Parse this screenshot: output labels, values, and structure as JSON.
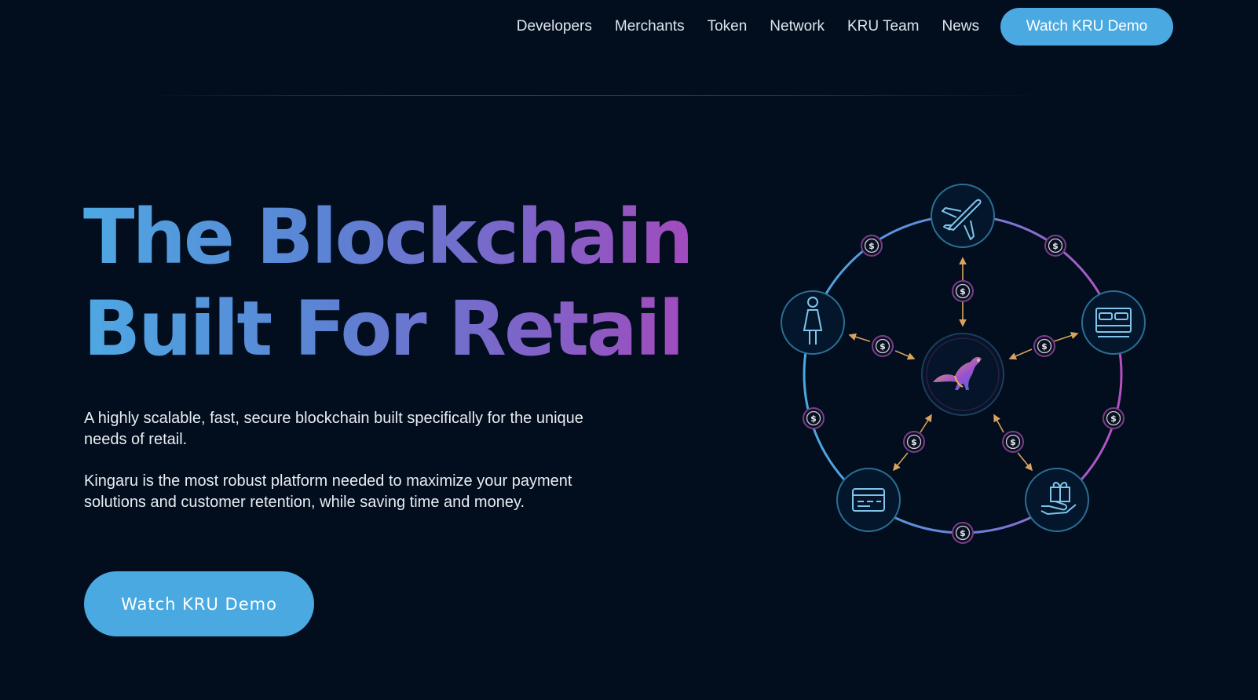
{
  "nav": {
    "links": [
      "Developers",
      "Merchants",
      "Token",
      "Network",
      "KRU Team",
      "News"
    ],
    "cta_label": "Watch KRU Demo"
  },
  "hero": {
    "title_line1": "The Blockchain",
    "title_line2": "Built For Retail",
    "paragraph1": "A highly scalable, fast, secure blockchain built specifically for the unique needs of retail.",
    "paragraph2": "Kingaru is the most robust platform needed to maximize your payment solutions and customer retention, while saving time and money.",
    "cta_label": "Watch KRU Demo"
  },
  "diagram": {
    "coin_symbol": "$",
    "colors": {
      "ring_start": "#4aa9e0",
      "ring_end": "#b84fc0",
      "node_stroke": "#2a6f93",
      "arrow": "#d9a25e",
      "coin_ring": "#7b3d8a"
    },
    "node_icons": [
      "airplane-icon",
      "bed-icon",
      "gift-hand-icon",
      "credit-card-icon",
      "person-icon"
    ],
    "center_icon": "kangaroo-logo-icon"
  }
}
